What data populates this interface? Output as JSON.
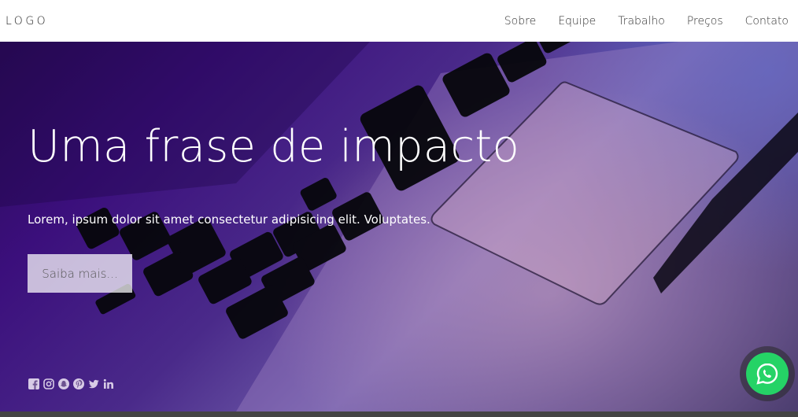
{
  "nav": {
    "logo": "LOGO",
    "items": [
      "Sobre",
      "Equipe",
      "Trabalho",
      "Preços",
      "Contato"
    ]
  },
  "hero": {
    "title": "Uma frase de impacto",
    "subtitle": "Lorem, ipsum dolor sit amet consectetur adipisicing elit. Voluptates.",
    "button_label": "Saiba mais..."
  },
  "social": {
    "icons": [
      "facebook-icon",
      "instagram-icon",
      "snapchat-icon",
      "pinterest-icon",
      "twitter-icon",
      "linkedin-icon"
    ]
  },
  "whatsapp": {
    "icon": "whatsapp-icon",
    "color": "#25d366"
  }
}
